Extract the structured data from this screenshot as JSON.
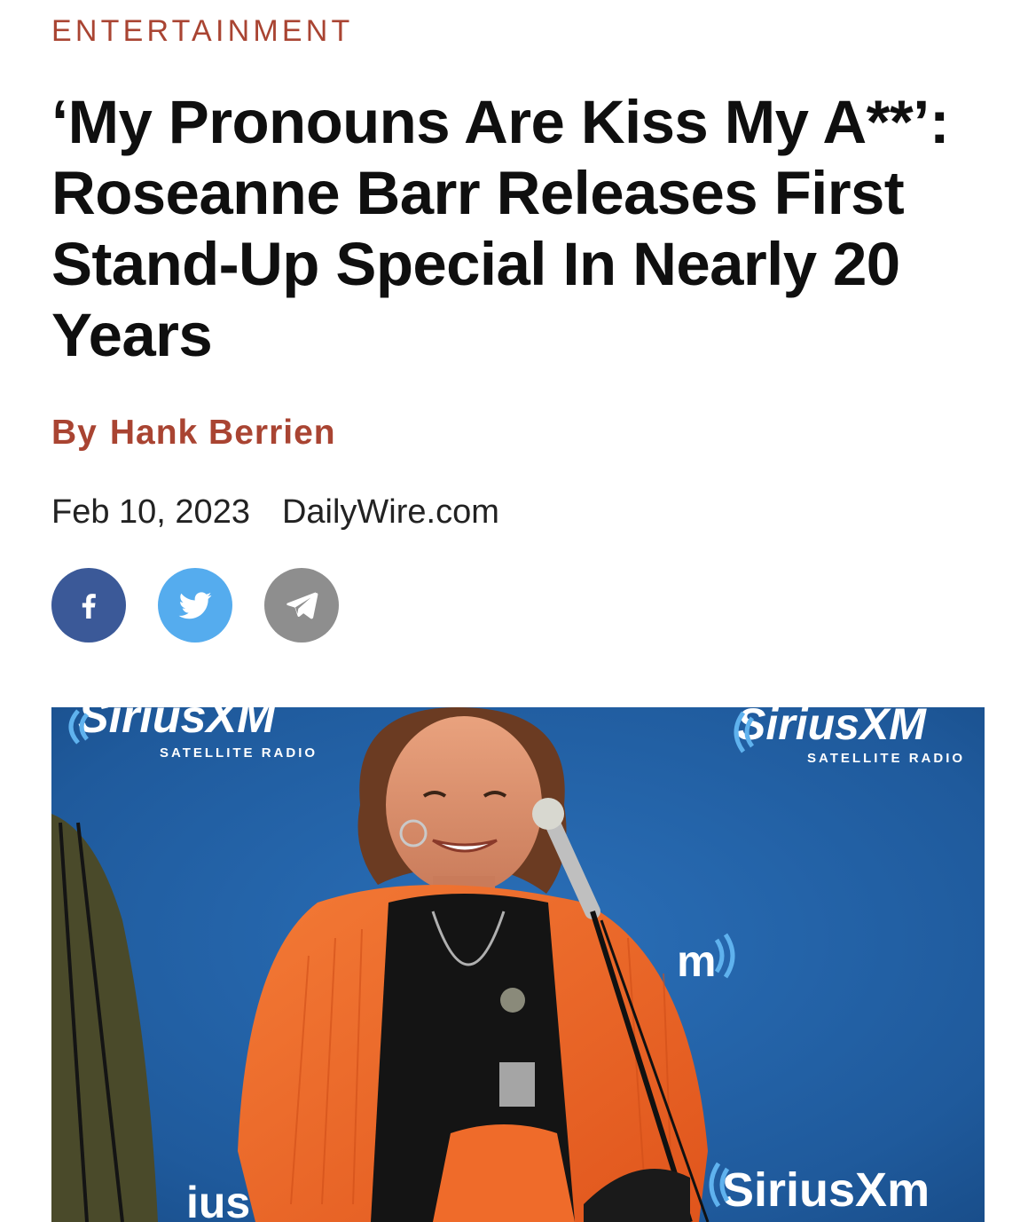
{
  "article": {
    "category": "ENTERTAINMENT",
    "headline": "‘My Pronouns Are Kiss My A**’: Roseanne Barr Releases First Stand-Up Special In Nearly 20 Years",
    "byline_prefix": "By",
    "author": "Hank Berrien",
    "date": "Feb 10, 2023",
    "source": "DailyWire.com"
  },
  "share": [
    {
      "network": "facebook",
      "icon": "facebook-icon",
      "color": "#3b5998"
    },
    {
      "network": "twitter",
      "icon": "twitter-bird-icon",
      "color": "#55acee"
    },
    {
      "network": "telegram",
      "icon": "paper-plane-icon",
      "color": "#8e8e8e"
    }
  ],
  "hero_image": {
    "backdrop_brand_left": "SiriusXM",
    "backdrop_sub_left": "SATELLITE RADIO",
    "backdrop_brand_right": "SiriusXM",
    "backdrop_sub_right": "SATELLITE RADIO",
    "backdrop_brand_bottom": "SiriusXm",
    "backdrop_fragment_bottom_left": "ius",
    "backdrop_fragment_mid": "m"
  },
  "colors": {
    "accent": "#a94432",
    "backdrop_blue": "#1f5fa8",
    "jacket_orange": "#f06a2a"
  }
}
